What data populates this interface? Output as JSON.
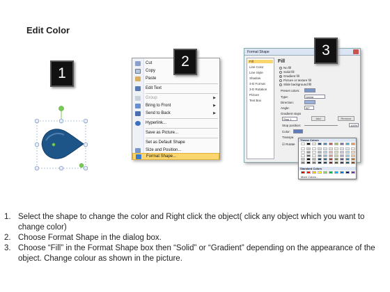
{
  "title": "Edit Color",
  "badges": [
    "1",
    "2",
    "3"
  ],
  "context_menu": {
    "items": [
      {
        "label": "Cut",
        "icon": "scissors-icon",
        "submenu": false,
        "disabled": false
      },
      {
        "label": "Copy",
        "icon": "copy-icon",
        "submenu": false,
        "disabled": false
      },
      {
        "label": "Paste",
        "icon": "paste-icon",
        "submenu": false,
        "disabled": false
      },
      {
        "label": "Edit Text",
        "icon": "edit-text-icon",
        "submenu": false,
        "disabled": false
      },
      {
        "label": "Group",
        "icon": "group-icon",
        "submenu": true,
        "disabled": true
      },
      {
        "label": "Bring to Front",
        "icon": "bring-front-icon",
        "submenu": true,
        "disabled": false
      },
      {
        "label": "Send to Back",
        "icon": "send-back-icon",
        "submenu": true,
        "disabled": false
      },
      {
        "label": "Hyperlink...",
        "icon": "hyperlink-icon",
        "submenu": false,
        "disabled": false
      },
      {
        "label": "Save as Picture...",
        "icon": "",
        "submenu": false,
        "disabled": false
      },
      {
        "label": "Set as Default Shape",
        "icon": "",
        "submenu": false,
        "disabled": false
      },
      {
        "label": "Size and Position...",
        "icon": "size-icon",
        "submenu": false,
        "disabled": false
      },
      {
        "label": "Format Shape...",
        "icon": "format-shape-icon",
        "submenu": false,
        "disabled": false,
        "highlighted": true
      }
    ]
  },
  "format_dialog": {
    "title": "Format Shape",
    "nav": [
      "Fill",
      "Line Color",
      "Line Style",
      "Shadow",
      "3-D Format",
      "3-D Rotation",
      "Picture",
      "Text Box"
    ],
    "heading": "Fill",
    "fill_options": [
      "No fill",
      "Solid fill",
      "Gradient fill",
      "Picture or texture fill",
      "Slide background fill"
    ],
    "selected_fill": "Gradient fill",
    "preset_colors_label": "Preset colors:",
    "type_label": "Type:",
    "type_value": "Linear",
    "direction_label": "Direction:",
    "angle_label": "Angle:",
    "angle_value": "90°",
    "gradient_stops_label": "Gradient stops",
    "stop_value": "Stop 1",
    "add_label": "Add",
    "remove_label": "Remove",
    "stop_position_label": "Stop position:",
    "stop_position_value": "100%",
    "color_label": "Color:",
    "transparency_label": "Transpa",
    "rotate_label": "Rotate",
    "picker": {
      "theme_label": "Theme Colors",
      "standard_label": "Standard Colors",
      "more_label": "More Colors...",
      "theme_top": [
        "#ffffff",
        "#000000",
        "#eeece1",
        "#1f497d",
        "#4f81bd",
        "#c0504d",
        "#9bbb59",
        "#8064a2",
        "#4bacc6",
        "#f79646"
      ],
      "standard": [
        "#c00000",
        "#ff0000",
        "#ffc000",
        "#ffff00",
        "#92d050",
        "#00b050",
        "#00b0f0",
        "#0070c0",
        "#002060",
        "#7030a0"
      ]
    }
  },
  "instructions": [
    {
      "num": "1.",
      "text": "Select the shape to change the color and Right click the object( click any object which you want to change color)"
    },
    {
      "num": "2.",
      "text": "Choose Format Shape in the dialog box."
    },
    {
      "num": "3.",
      "text": "Choose “Fill” in the Format Shape box then “Solid” or “Gradient” depending on the appearance of the object. Change colour as shown in the picture."
    }
  ],
  "colors": {
    "shape_fill": "#1d5588",
    "highlight": "#fbd66e",
    "handle_green": "#7acb55"
  }
}
